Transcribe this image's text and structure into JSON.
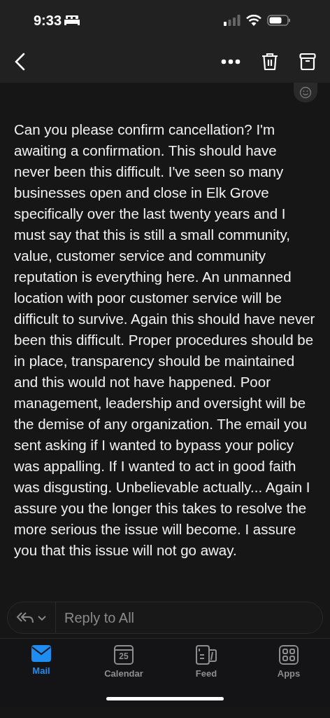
{
  "status_bar": {
    "time": "9:33"
  },
  "message": {
    "body": "Can you please confirm cancellation? I'm awaiting a confirmation. This should have never been this difficult. I've seen so many businesses open and close in Elk Grove specifically over the last twenty years and I must say that this is still a small community, value, customer service  and community reputation is everything here. An unmanned location with poor customer service  will be difficult to survive.  Again this should have never been this difficult. Proper procedures should be in place, transparency should be maintained and this would not have happened. Poor management, leadership and oversight will be the demise of any organization. The email you sent asking if I wanted to bypass your policy was appalling. If I wanted to act in good faith was disgusting. Unbelievable actually... Again I assure you the longer this takes to resolve the more serious the issue will become. I assure you that this issue will not go away."
  },
  "reply_bar": {
    "placeholder": "Reply to All"
  },
  "tabs": [
    {
      "kind": "mail",
      "label": "Mail",
      "selected": true
    },
    {
      "kind": "calendar",
      "label": "Calendar",
      "icon_text": "25",
      "selected": false
    },
    {
      "kind": "feed",
      "label": "Feed",
      "selected": false
    },
    {
      "kind": "apps",
      "label": "Apps",
      "selected": false
    }
  ]
}
